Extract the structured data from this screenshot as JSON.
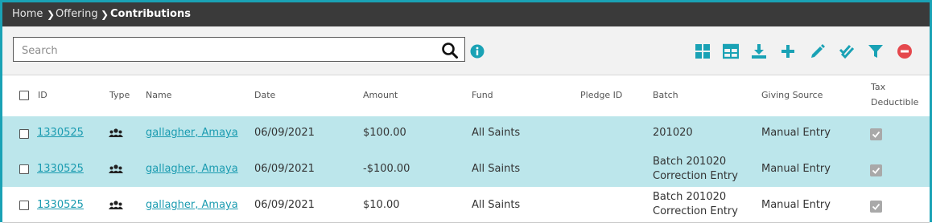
{
  "breadcrumb": {
    "home": "Home",
    "offering": "Offering",
    "current": "Contributions"
  },
  "search": {
    "placeholder": "Search",
    "value": ""
  },
  "toolbar": {
    "icons": [
      "grid-view-icon",
      "table-view-icon",
      "download-icon",
      "add-icon",
      "edit-icon",
      "approve-icon",
      "filter-icon",
      "remove-icon"
    ]
  },
  "colors": {
    "accent": "#1aa2b5",
    "highlight_row": "#bce6eb",
    "header_bar": "#3a3a3a",
    "remove": "#e5484d"
  },
  "table": {
    "columns": {
      "id": "ID",
      "type": "Type",
      "name": "Name",
      "date": "Date",
      "amount": "Amount",
      "fund": "Fund",
      "pledge_id": "Pledge ID",
      "batch": "Batch",
      "giving_source": "Giving Source",
      "tax_line1": "Tax",
      "tax_line2": "Deductible"
    },
    "rows": [
      {
        "id": "1330525",
        "type": "group-icon",
        "name": "gallagher, Amaya",
        "date": "06/09/2021",
        "amount": "$100.00",
        "fund": "All Saints",
        "pledge_id": "",
        "batch_line1": "201020",
        "batch_line2": "",
        "giving_source": "Manual Entry",
        "tax_deductible": true,
        "highlighted": true
      },
      {
        "id": "1330525",
        "type": "group-icon",
        "name": "gallagher, Amaya",
        "date": "06/09/2021",
        "amount": "-$100.00",
        "fund": "All Saints",
        "pledge_id": "",
        "batch_line1": "Batch 201020",
        "batch_line2": "Correction Entry",
        "giving_source": "Manual Entry",
        "tax_deductible": true,
        "highlighted": true
      },
      {
        "id": "1330525",
        "type": "group-icon",
        "name": "gallagher, Amaya",
        "date": "06/09/2021",
        "amount": "$10.00",
        "fund": "All Saints",
        "pledge_id": "",
        "batch_line1": "Batch 201020",
        "batch_line2": "Correction Entry",
        "giving_source": "Manual Entry",
        "tax_deductible": true,
        "highlighted": false
      }
    ]
  }
}
